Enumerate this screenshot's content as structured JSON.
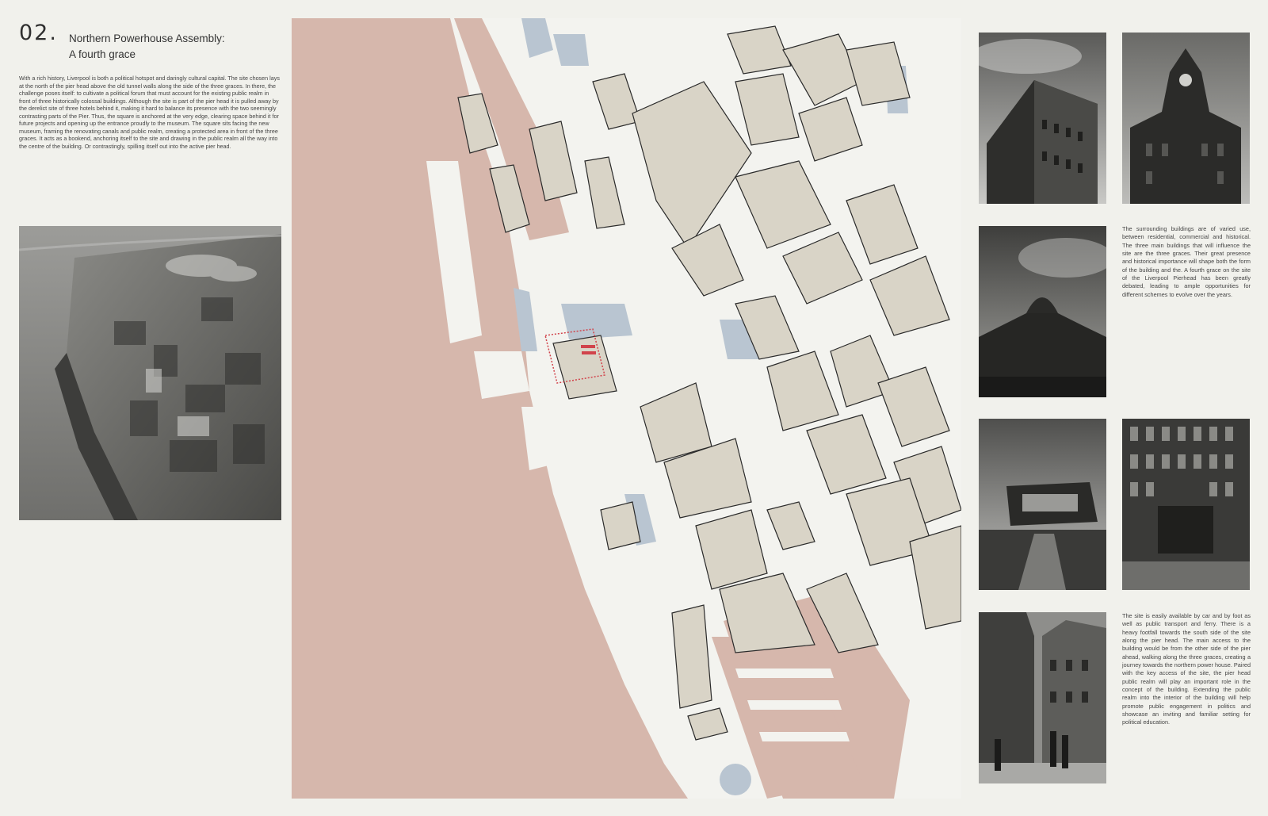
{
  "header": {
    "section_number": "02.",
    "title_line1": "Northern Powerhouse Assembly:",
    "title_line2": "A fourth grace"
  },
  "intro_text": "With a rich history, Liverpool is both a political hotspot and daringly cultural capital. The site chosen lays at the north of the pier head above the old tunnel walls along the side of the three graces. In there, the challenge poses itself: to cultivate a political forum that must account for the existing public realm in front of three historically colossal buildings. Although the site is part of the pier head it is pulled away by the derelict site of three hotels behind it, making it hard to balance its presence with the two seemingly contrasting parts of the Pier. Thus, the square is anchored at the very edge, clearing space behind it for future projects and opening up the entrance proudly to the museum. The square sits facing the new museum, framing the renovating canals and public realm, creating a protected area in front of the three graces. It acts as a bookend, anchoring itself to the site and drawing in the public realm all the way into the centre of the building. Or contrastingly, spilling itself out into the active pier head.",
  "surrounding_text": "The surrounding buildings are of varied use, between residential, commercial and historical. The three main buildings that will influence the site are the three graces. Their great presence and historical importance will shape both the form of the building and the. A fourth grace on the site of the Liverpool Pierhead has been greatly debated, leading to ample opportunities for different schemes to evolve over the years.",
  "access_text": "The site is easily available by car and by foot as well as public transport and ferry. There is a heavy footfall towards the south side of the site along the pier head. The main access to the building would be from the other side of the pier ahead, walking along the three graces, creating a journey towards the northern power house. Paired with the key access of the site, the pier head public realm will play an important role in the concept of the building. Extending the public realm into the interior of the building will help promote public engagement in politics and showcase an inviting and familiar setting for political education.",
  "colors": {
    "background": "#f1f1ec",
    "water": "#d6b7ac",
    "buildings": "#d9d4c7",
    "canals": "#b9c5d1",
    "site": "#d1434b"
  }
}
